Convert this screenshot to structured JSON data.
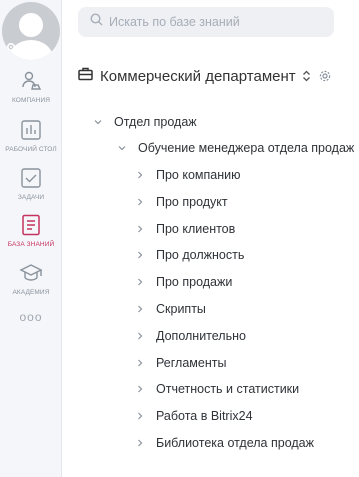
{
  "sidebar": {
    "items": [
      {
        "label": "Компания",
        "icon": "company-icon",
        "active": false
      },
      {
        "label": "Рабочий стол",
        "icon": "desktop-icon",
        "active": false
      },
      {
        "label": "Задачи",
        "icon": "tasks-icon",
        "active": false
      },
      {
        "label": "База знаний",
        "icon": "knowledge-base-icon",
        "active": true
      },
      {
        "label": "Академия",
        "icon": "academy-icon",
        "active": false
      }
    ],
    "more": "ooo"
  },
  "search": {
    "placeholder": "Искать по базе знаний"
  },
  "header": {
    "title": "Коммерческий департамент"
  },
  "tree": {
    "root": "Отдел продаж",
    "child": "Обучение менеджера отдела продаж",
    "items": [
      "Про компанию",
      "Про продукт",
      "Про клиентов",
      "Про должность",
      "Про продажи",
      "Скрипты",
      "Дополнительно",
      "Регламенты",
      "Отчетность и статистики",
      "Работа в Bitrix24",
      "Библиотека отдела продаж"
    ]
  },
  "colors": {
    "accent": "#c6325f",
    "icon": "#8a929c",
    "sidebar_bg": "#f4f6f9",
    "search_bg": "#eef0f3"
  }
}
